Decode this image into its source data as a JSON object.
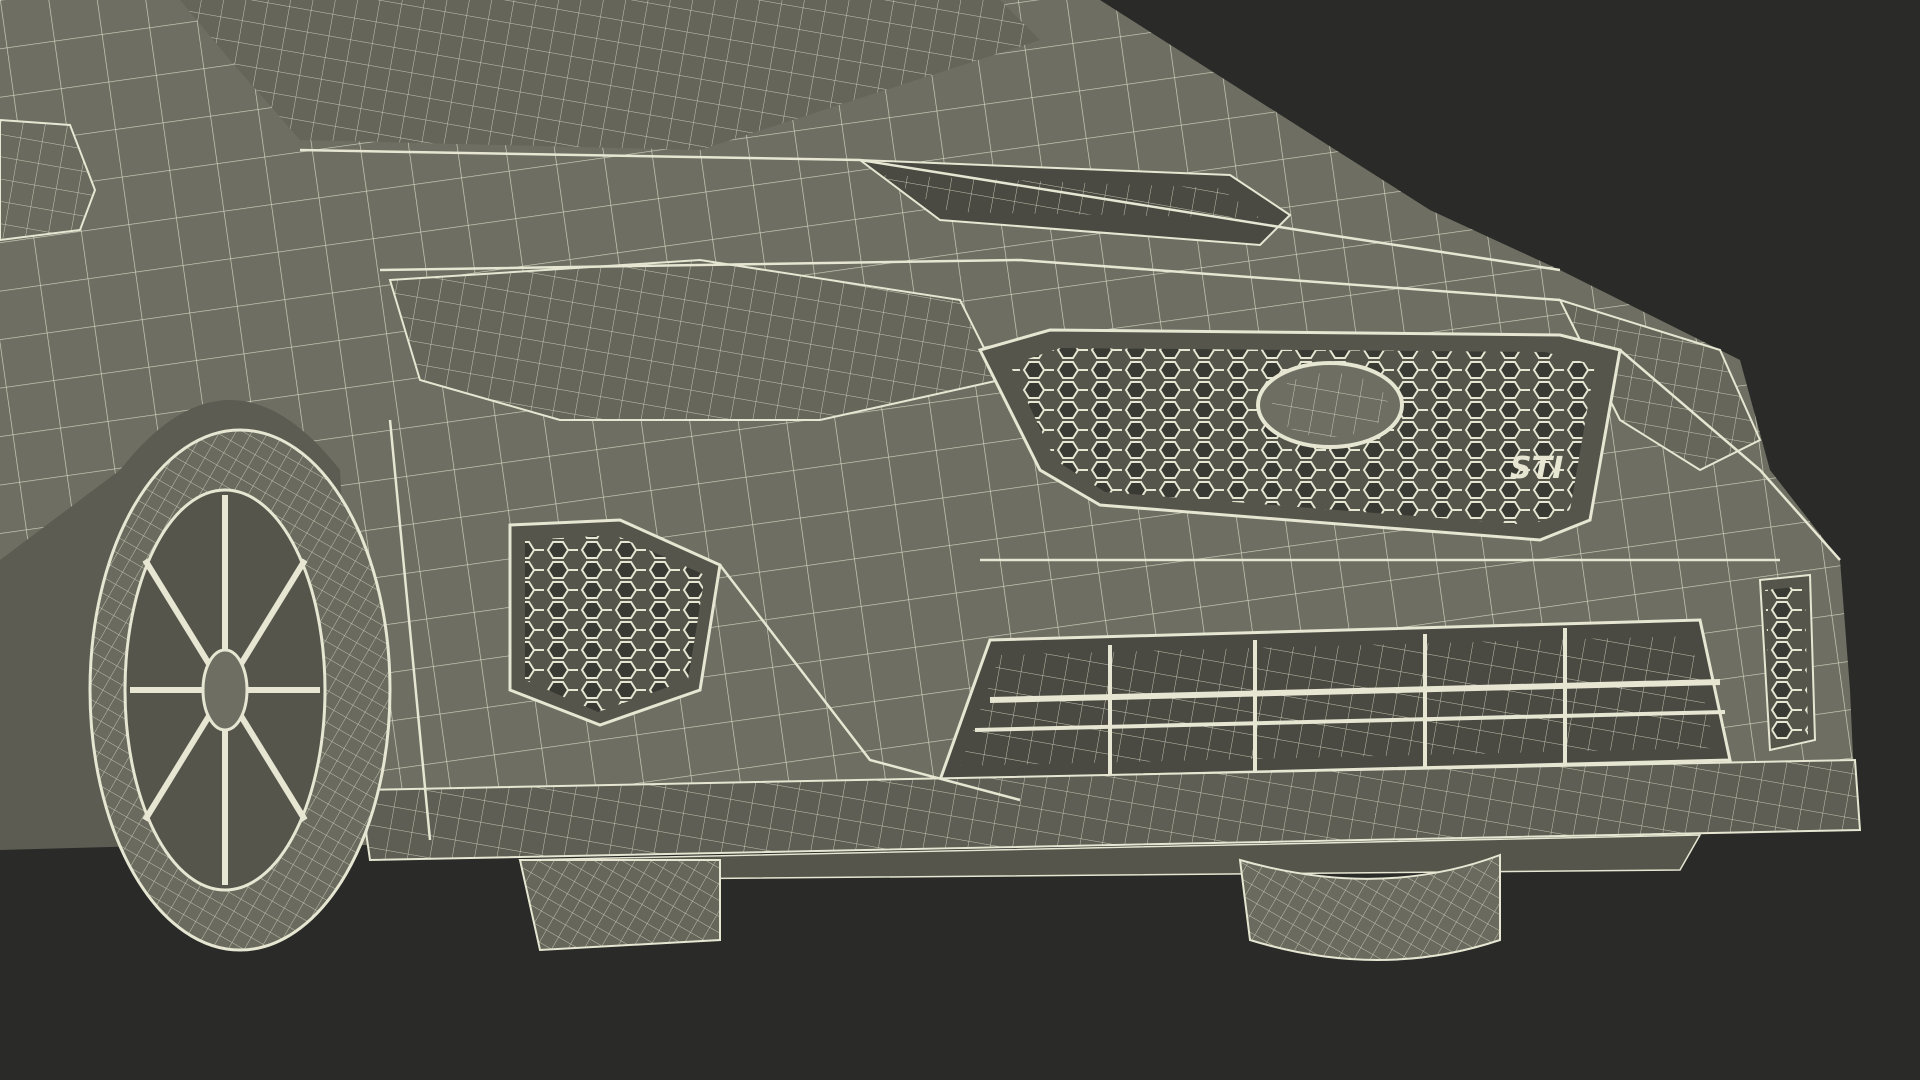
{
  "scene": {
    "subject": "car-front-wireframe",
    "background_color": "#2a2a28",
    "body_color": "#6e6e62",
    "body_shadow_color": "#55554b",
    "wire_color": "#e6e6d2",
    "dark_recess_color": "#4a4a42",
    "emblem_text": "STI"
  }
}
